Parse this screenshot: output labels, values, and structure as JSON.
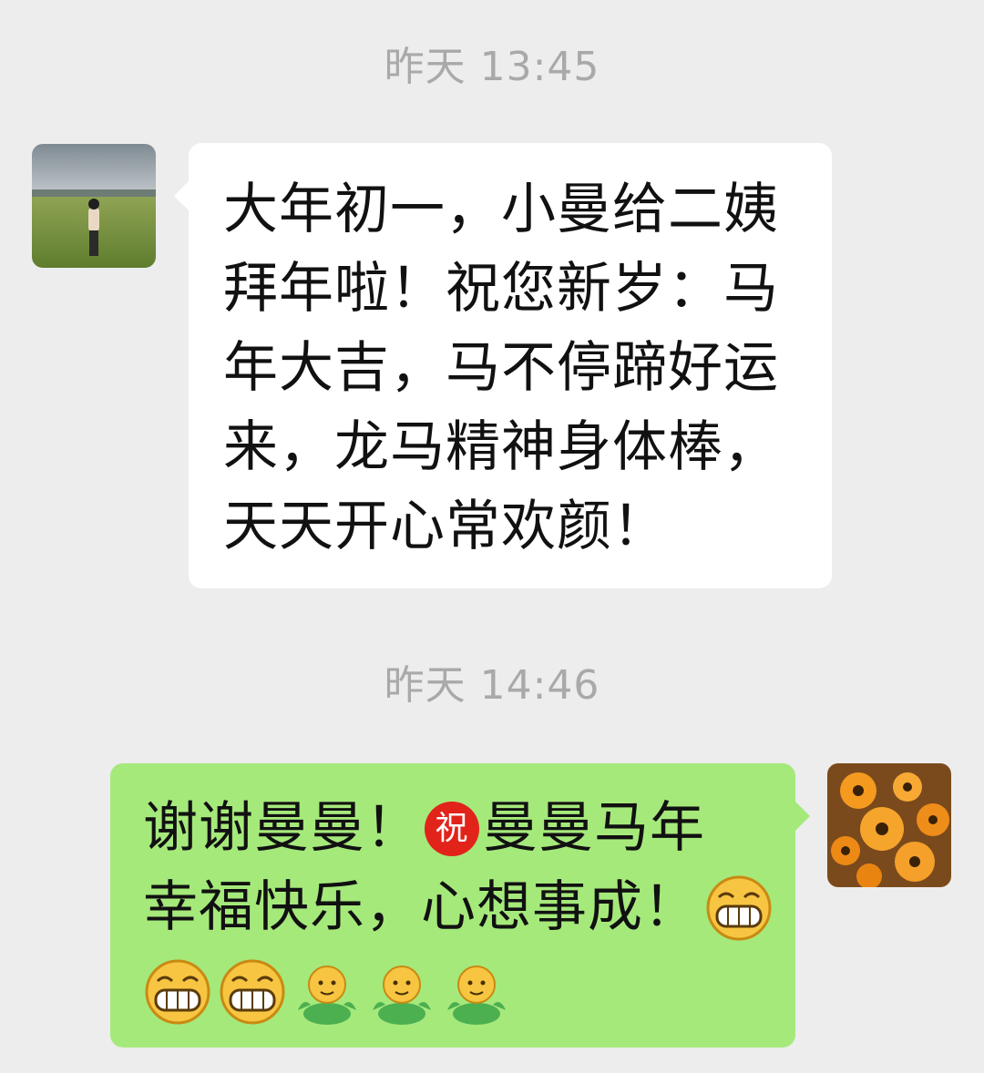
{
  "chat": {
    "messages": [
      {
        "timestamp": "昨天 13:45",
        "direction": "incoming",
        "lines": [
          "大年初一，小曼给二姨",
          "拜年啦！祝您新岁：马",
          "年大吉，马不停蹄好运",
          "来，龙马精神身体棒，",
          "天天开心常欢颜！"
        ]
      },
      {
        "timestamp": "昨天 14:46",
        "direction": "outgoing",
        "line1_pre": "谢谢曼曼！",
        "line1_badge": "祝",
        "line1_post": "曼曼马年",
        "line2": "幸福快乐，心想事成！",
        "emojis_line2": [
          "grin-emoji"
        ],
        "emojis_line3": [
          "grin-emoji",
          "grin-emoji",
          "hug-emoji",
          "hug-emoji",
          "hug-emoji"
        ]
      }
    ]
  },
  "colors": {
    "background": "#ededed",
    "incoming_bubble": "#ffffff",
    "outgoing_bubble": "#a5e97b",
    "timestamp_text": "#a9a9a9",
    "badge_red": "#e2231a"
  }
}
